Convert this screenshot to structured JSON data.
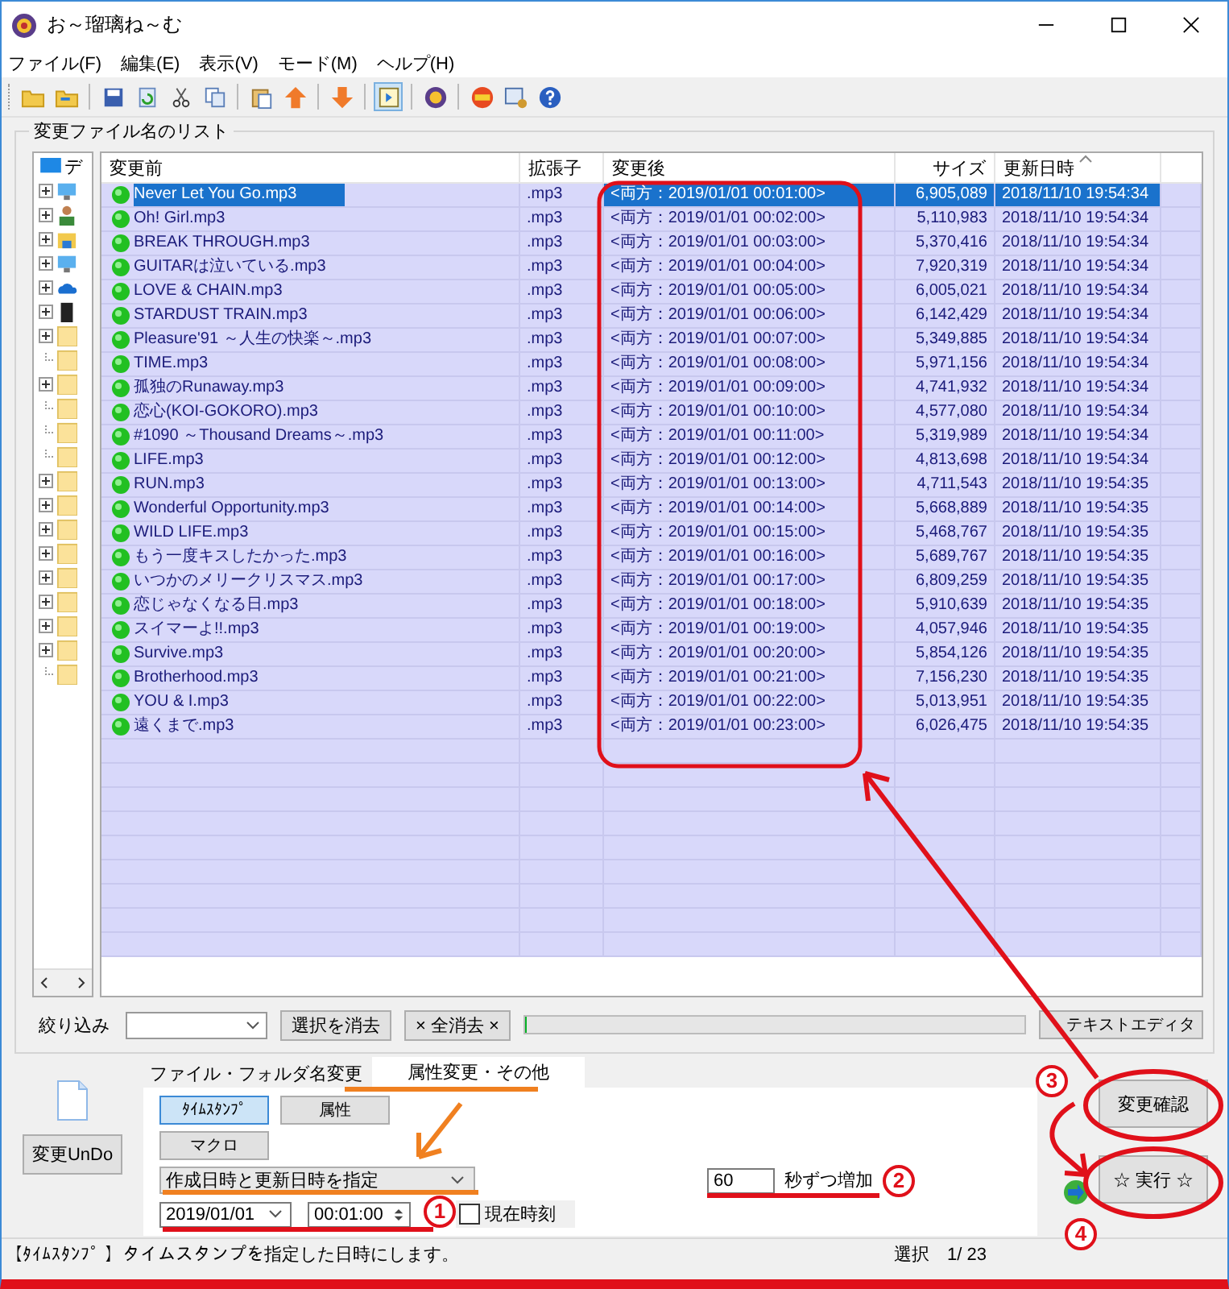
{
  "window": {
    "title": "お～瑠璃ね～む"
  },
  "menu": [
    "ファイル(F)",
    "編集(E)",
    "表示(V)",
    "モード(M)",
    "ヘルプ(H)"
  ],
  "toolbar": [
    [
      {
        "kind": "folder",
        "pressed": false
      },
      {
        "kind": "folder-arrow",
        "pressed": false
      }
    ],
    [
      {
        "kind": "save",
        "pressed": false
      },
      {
        "kind": "refresh",
        "pressed": false
      },
      {
        "kind": "cut",
        "pressed": false
      },
      {
        "kind": "copy",
        "pressed": false
      }
    ],
    [
      {
        "kind": "paste",
        "pressed": false
      },
      {
        "kind": "up",
        "pressed": false
      }
    ],
    [
      {
        "kind": "down",
        "pressed": false
      }
    ],
    [
      {
        "kind": "panel",
        "pressed": true
      }
    ],
    [
      {
        "kind": "logo",
        "pressed": false
      }
    ],
    [
      {
        "kind": "badge",
        "pressed": false
      },
      {
        "kind": "window-gear",
        "pressed": false
      },
      {
        "kind": "help",
        "pressed": false
      }
    ]
  ],
  "list_group": {
    "title": "変更ファイル名のリスト"
  },
  "tree": {
    "label": "デ",
    "children": [
      {
        "kind": "computer",
        "expandable": true
      },
      {
        "kind": "user",
        "expandable": true
      },
      {
        "kind": "network",
        "expandable": true
      },
      {
        "kind": "desktop",
        "expandable": true
      },
      {
        "kind": "cloud",
        "expandable": true
      },
      {
        "kind": "drive",
        "expandable": true
      },
      {
        "kind": "folder",
        "expandable": true
      },
      {
        "kind": "folder",
        "expandable": false
      },
      {
        "kind": "folder",
        "expandable": true
      },
      {
        "kind": "folder",
        "expandable": false
      },
      {
        "kind": "folder",
        "expandable": false
      },
      {
        "kind": "folder",
        "expandable": false
      },
      {
        "kind": "folder",
        "expandable": true
      },
      {
        "kind": "folder",
        "expandable": true
      },
      {
        "kind": "folder",
        "expandable": true
      },
      {
        "kind": "folder",
        "expandable": true
      },
      {
        "kind": "folder",
        "expandable": true
      },
      {
        "kind": "folder",
        "expandable": true
      },
      {
        "kind": "folder",
        "expandable": true
      },
      {
        "kind": "folder",
        "expandable": true
      },
      {
        "kind": "folder",
        "expandable": false
      }
    ]
  },
  "table": {
    "columns": [
      "変更前",
      "拡張子",
      "変更後",
      "サイズ",
      "更新日時"
    ],
    "rows": [
      {
        "name": "Never Let You Go.mp3",
        "ext": ".mp3",
        "after": "<両方：2019/01/01 00:01:00>",
        "size": "6,905,089",
        "modified": "2018/11/10 19:54:34",
        "selected": true
      },
      {
        "name": "Oh! Girl.mp3",
        "ext": ".mp3",
        "after": "<両方：2019/01/01 00:02:00>",
        "size": "5,110,983",
        "modified": "2018/11/10 19:54:34",
        "selected": false
      },
      {
        "name": "BREAK THROUGH.mp3",
        "ext": ".mp3",
        "after": "<両方：2019/01/01 00:03:00>",
        "size": "5,370,416",
        "modified": "2018/11/10 19:54:34",
        "selected": false
      },
      {
        "name": "GUITARは泣いている.mp3",
        "ext": ".mp3",
        "after": "<両方：2019/01/01 00:04:00>",
        "size": "7,920,319",
        "modified": "2018/11/10 19:54:34",
        "selected": false
      },
      {
        "name": "LOVE & CHAIN.mp3",
        "ext": ".mp3",
        "after": "<両方：2019/01/01 00:05:00>",
        "size": "6,005,021",
        "modified": "2018/11/10 19:54:34",
        "selected": false
      },
      {
        "name": "STARDUST TRAIN.mp3",
        "ext": ".mp3",
        "after": "<両方：2019/01/01 00:06:00>",
        "size": "6,142,429",
        "modified": "2018/11/10 19:54:34",
        "selected": false
      },
      {
        "name": "Pleasure'91 ～人生の快楽～.mp3",
        "ext": ".mp3",
        "after": "<両方：2019/01/01 00:07:00>",
        "size": "5,349,885",
        "modified": "2018/11/10 19:54:34",
        "selected": false
      },
      {
        "name": "TIME.mp3",
        "ext": ".mp3",
        "after": "<両方：2019/01/01 00:08:00>",
        "size": "5,971,156",
        "modified": "2018/11/10 19:54:34",
        "selected": false
      },
      {
        "name": "孤独のRunaway.mp3",
        "ext": ".mp3",
        "after": "<両方：2019/01/01 00:09:00>",
        "size": "4,741,932",
        "modified": "2018/11/10 19:54:34",
        "selected": false
      },
      {
        "name": "恋心(KOI-GOKORO).mp3",
        "ext": ".mp3",
        "after": "<両方：2019/01/01 00:10:00>",
        "size": "4,577,080",
        "modified": "2018/11/10 19:54:34",
        "selected": false
      },
      {
        "name": "#1090 ～Thousand Dreams～.mp3",
        "ext": ".mp3",
        "after": "<両方：2019/01/01 00:11:00>",
        "size": "5,319,989",
        "modified": "2018/11/10 19:54:34",
        "selected": false
      },
      {
        "name": "LIFE.mp3",
        "ext": ".mp3",
        "after": "<両方：2019/01/01 00:12:00>",
        "size": "4,813,698",
        "modified": "2018/11/10 19:54:34",
        "selected": false
      },
      {
        "name": "RUN.mp3",
        "ext": ".mp3",
        "after": "<両方：2019/01/01 00:13:00>",
        "size": "4,711,543",
        "modified": "2018/11/10 19:54:35",
        "selected": false
      },
      {
        "name": "Wonderful Opportunity.mp3",
        "ext": ".mp3",
        "after": "<両方：2019/01/01 00:14:00>",
        "size": "5,668,889",
        "modified": "2018/11/10 19:54:35",
        "selected": false
      },
      {
        "name": "WILD LIFE.mp3",
        "ext": ".mp3",
        "after": "<両方：2019/01/01 00:15:00>",
        "size": "5,468,767",
        "modified": "2018/11/10 19:54:35",
        "selected": false
      },
      {
        "name": "もう一度キスしたかった.mp3",
        "ext": ".mp3",
        "after": "<両方：2019/01/01 00:16:00>",
        "size": "5,689,767",
        "modified": "2018/11/10 19:54:35",
        "selected": false
      },
      {
        "name": "いつかのメリークリスマス.mp3",
        "ext": ".mp3",
        "after": "<両方：2019/01/01 00:17:00>",
        "size": "6,809,259",
        "modified": "2018/11/10 19:54:35",
        "selected": false
      },
      {
        "name": "恋じゃなくなる日.mp3",
        "ext": ".mp3",
        "after": "<両方：2019/01/01 00:18:00>",
        "size": "5,910,639",
        "modified": "2018/11/10 19:54:35",
        "selected": false
      },
      {
        "name": "スイマーよ!!.mp3",
        "ext": ".mp3",
        "after": "<両方：2019/01/01 00:19:00>",
        "size": "4,057,946",
        "modified": "2018/11/10 19:54:35",
        "selected": false
      },
      {
        "name": "Survive.mp3",
        "ext": ".mp3",
        "after": "<両方：2019/01/01 00:20:00>",
        "size": "5,854,126",
        "modified": "2018/11/10 19:54:35",
        "selected": false
      },
      {
        "name": "Brotherhood.mp3",
        "ext": ".mp3",
        "after": "<両方：2019/01/01 00:21:00>",
        "size": "7,156,230",
        "modified": "2018/11/10 19:54:35",
        "selected": false
      },
      {
        "name": "YOU & I.mp3",
        "ext": ".mp3",
        "after": "<両方：2019/01/01 00:22:00>",
        "size": "5,013,951",
        "modified": "2018/11/10 19:54:35",
        "selected": false
      },
      {
        "name": "遠くまで.mp3",
        "ext": ".mp3",
        "after": "<両方：2019/01/01 00:23:00>",
        "size": "6,026,475",
        "modified": "2018/11/10 19:54:35",
        "selected": false
      }
    ]
  },
  "filter": {
    "label": "絞り込み",
    "clear_selection": "選択を消去",
    "clear_all": "× 全消去 ×",
    "text_editor": "テキストエディタ",
    "progress": {
      "level": 0
    }
  },
  "undo_button": "変更UnDo",
  "tabs": [
    {
      "label": "ファイル・フォルダ名変更",
      "selected": false
    },
    {
      "label": "属性変更・その他",
      "selected": true
    }
  ],
  "modes": [
    {
      "label": "ﾀｲﾑｽﾀﾝﾌﾟ",
      "selected": true
    },
    {
      "label": "属性",
      "selected": false
    },
    {
      "label": "マクロ",
      "selected": false
    }
  ],
  "timestamp": {
    "target": "作成日時と更新日時を指定",
    "date": "2019/01/01",
    "time": "00:01:00",
    "now_label": "現在時刻",
    "now_checked": false,
    "step": "60",
    "step_label": "秒ずつ増加"
  },
  "confirm_button": "変更確認",
  "run_button": "☆ 実行 ☆",
  "status_bar": {
    "message": "【ﾀｲﾑｽﾀﾝﾌﾟ 】タイムスタンプを指定した日時にします。",
    "selection": "選択　1/ 23"
  },
  "annotations": {
    "markers": [
      "1",
      "2",
      "3",
      "4"
    ]
  }
}
